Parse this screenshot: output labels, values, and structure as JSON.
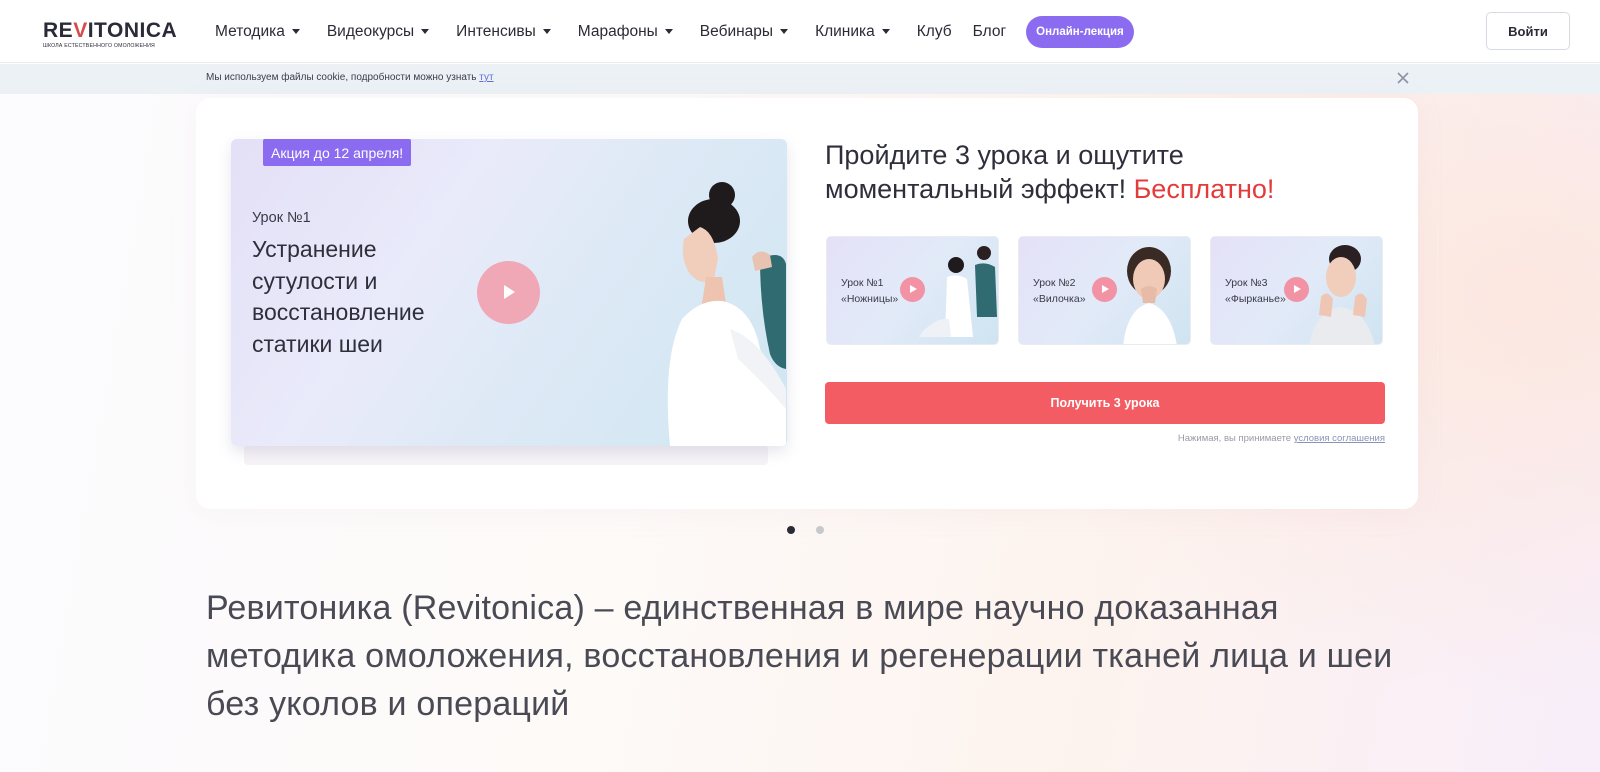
{
  "header": {
    "logo_main": "REVITONICA",
    "logo_sub": "ШКОЛА ЕСТЕСТВЕННОГО ОМОЛОЖЕНИЯ",
    "nav": [
      {
        "label": "Методика",
        "dropdown": true
      },
      {
        "label": "Видеокурсы",
        "dropdown": true
      },
      {
        "label": "Интенсивы",
        "dropdown": true
      },
      {
        "label": "Марафоны",
        "dropdown": true
      },
      {
        "label": "Вебинары",
        "dropdown": true
      },
      {
        "label": "Клиника",
        "dropdown": true
      },
      {
        "label": "Клуб",
        "dropdown": false
      },
      {
        "label": "Блог",
        "dropdown": false
      }
    ],
    "pill_label": "Онлайн-лекция",
    "login_label": "Войти"
  },
  "cookie": {
    "text": "Мы используем файлы cookie, подробности можно узнать ",
    "link": "тут"
  },
  "hero": {
    "badge": "Акция до 12 апреля!",
    "lesson_num": "Урок №1",
    "lesson_title": "Устранение сутулости и восстановление статики шеи",
    "headline_main": "Пройдите 3 урока и ощутите моментальный эффект! ",
    "headline_accent": "Бесплатно!",
    "thumbs": [
      {
        "num": "Урок №1",
        "name": "«Ножницы»"
      },
      {
        "num": "Урок №2",
        "name": "«Вилочка»"
      },
      {
        "num": "Урок №3",
        "name": "«Фырканье»"
      }
    ],
    "cta_label": "Получить 3 урока",
    "agree_text": "Нажимая, вы принимаете ",
    "agree_link": "условия соглашения"
  },
  "carousel": {
    "total": 2,
    "active": 1
  },
  "intro": "Ревитоника (Revitonica) – единственная в мире научно доказанная методика омоложения, восстановления и регенерации тканей лица и шеи без уколов и операций",
  "colors": {
    "accent": "#8b6cf0",
    "cta": "#f35c62",
    "highlight": "#e33b3b"
  }
}
